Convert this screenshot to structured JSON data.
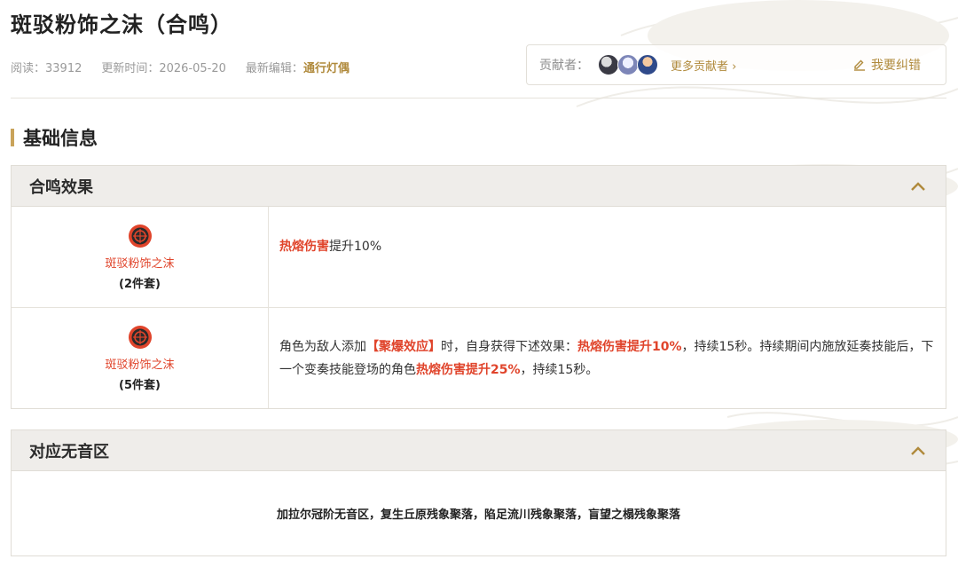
{
  "page": {
    "title": "斑驳粉饰之沫（合鸣）",
    "meta": {
      "views_label": "阅读：33912",
      "updated_label": "更新时间：2026-05-20",
      "editor_prefix": "最新编辑：",
      "editor_name": "通行灯偶"
    },
    "contributors": {
      "label": "贡献者：",
      "more": "更多贡献者 ›",
      "report": "我要纠错"
    }
  },
  "section": {
    "title": "基础信息"
  },
  "resonance_panel": {
    "title": "合鸣效果",
    "rows": [
      {
        "set_name": "斑驳粉饰之沫",
        "count": "(2件套)",
        "parts": [
          {
            "text": "热熔伤害",
            "hl": true
          },
          {
            "text": "提升10%",
            "hl": false
          }
        ]
      },
      {
        "set_name": "斑驳粉饰之沫",
        "count": "(5件套)",
        "parts": [
          {
            "text": "角色为敌人添加",
            "hl": false
          },
          {
            "text": "【聚爆效应】",
            "hl": true
          },
          {
            "text": "时，自身获得下述效果：",
            "hl": false
          },
          {
            "text": "热熔伤害提升10%",
            "hl": true
          },
          {
            "text": "，持续15秒。持续期间内施放延奏技能后，下一个变奏技能登场的角色",
            "hl": false
          },
          {
            "text": "热熔伤害提升25%",
            "hl": true
          },
          {
            "text": "，持续15秒。",
            "hl": false
          }
        ]
      }
    ]
  },
  "zone_panel": {
    "title": "对应无音区",
    "text": "加拉尔冠阶无音区，复生丘原残象聚落，陷足流川残象聚落，盲望之榻残象聚落"
  },
  "colors": {
    "accent_gold": "#c9a35a",
    "highlight_red": "#e0442b",
    "panel_head_bg": "#efedea"
  }
}
